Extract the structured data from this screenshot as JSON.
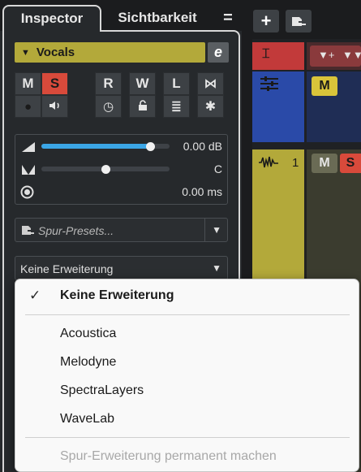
{
  "tabs": {
    "inspector": "Inspector",
    "visibility": "Sichtbarkeit",
    "menu_glyph": "="
  },
  "track": {
    "name": "Vocals",
    "color": "#b3a93a",
    "edit_glyph": "e"
  },
  "buttons": {
    "mute": "M",
    "solo": "S",
    "read": "R",
    "write": "W",
    "listen": "L",
    "freeze_glyph": "⋈",
    "record_glyph": "●",
    "monitor_glyph": "🔈",
    "timebase_glyph": "◷",
    "lock_glyph": "🔓",
    "lanes_glyph": "≣",
    "extra_glyph": "✱"
  },
  "faders": {
    "volume_value": "0.00 dB",
    "volume_level": 0.85,
    "pan_value": "C",
    "pan_level": 0.5,
    "delay_value": "0.00 ms"
  },
  "presets": {
    "placeholder": "Spur-Presets..."
  },
  "extension": {
    "selected": "Keine Erweiterung"
  },
  "menu": {
    "check_glyph": "✓",
    "selected": "Keine Erweiterung",
    "options": [
      "Acoustica",
      "Melodyne",
      "SpectraLayers",
      "WaveLab"
    ],
    "permanent": "Spur-Erweiterung permanent machen"
  },
  "project": {
    "add_glyph": "+",
    "track_number": "1",
    "blue_mute": "M",
    "yellow_mute": "M",
    "yellow_solo": "S"
  },
  "colors": {
    "accent_blue": "#3ba6e6",
    "solo_red": "#d84a3b",
    "track_yellow": "#b3a93a",
    "track_blue": "#2a4aa8",
    "track_red": "#c23a3a"
  }
}
